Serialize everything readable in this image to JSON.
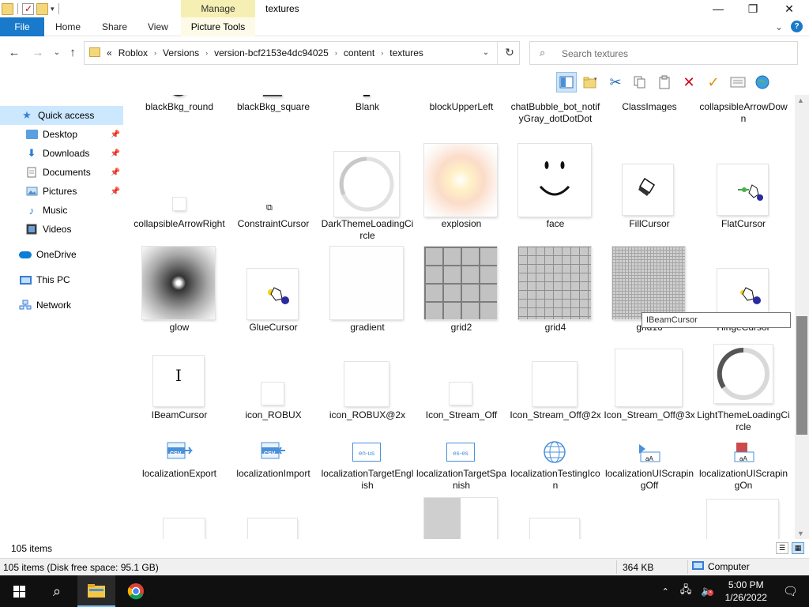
{
  "window": {
    "title": "textures",
    "manage_label": "Manage",
    "minimize": "—",
    "maximize": "❐",
    "close": "✕"
  },
  "ribbon": {
    "file": "File",
    "home": "Home",
    "share": "Share",
    "view": "View",
    "picture_tools": "Picture Tools",
    "collapse": "⌄",
    "help": "?"
  },
  "address": {
    "overflow": "«",
    "crumbs": [
      "Roblox",
      "Versions",
      "version-bcf2153e4dc94025",
      "content",
      "textures"
    ],
    "search_placeholder": "Search textures"
  },
  "navpane": {
    "items": [
      {
        "label": "Quick access",
        "icon": "star-icon"
      },
      {
        "label": "Desktop",
        "icon": "desktop-icon"
      },
      {
        "label": "Downloads",
        "icon": "downloads-icon"
      },
      {
        "label": "Documents",
        "icon": "documents-icon"
      },
      {
        "label": "Pictures",
        "icon": "pictures-icon"
      },
      {
        "label": "Music",
        "icon": "music-icon"
      },
      {
        "label": "Videos",
        "icon": "videos-icon"
      },
      {
        "label": "OneDrive",
        "icon": "onedrive-icon"
      },
      {
        "label": "This PC",
        "icon": "this-pc-icon"
      },
      {
        "label": "Network",
        "icon": "network-icon"
      }
    ]
  },
  "files": [
    {
      "name": "blackBkg_round"
    },
    {
      "name": "blackBkg_square"
    },
    {
      "name": "Blank"
    },
    {
      "name": "blockUpperLeft"
    },
    {
      "name": "chatBubble_bot_notifyGray_dotDotDot"
    },
    {
      "name": "ClassImages"
    },
    {
      "name": "collapsibleArrowDown"
    },
    {
      "name": "collapsibleArrowRight"
    },
    {
      "name": "ConstraintCursor"
    },
    {
      "name": "DarkThemeLoadingCircle"
    },
    {
      "name": "explosion"
    },
    {
      "name": "face"
    },
    {
      "name": "FillCursor"
    },
    {
      "name": "FlatCursor"
    },
    {
      "name": "glow"
    },
    {
      "name": "GlueCursor"
    },
    {
      "name": "gradient"
    },
    {
      "name": "grid2"
    },
    {
      "name": "grid4"
    },
    {
      "name": "grid16"
    },
    {
      "name": "HingeCursor"
    },
    {
      "name": "IBeamCursor"
    },
    {
      "name": "icon_ROBUX"
    },
    {
      "name": "icon_ROBUX@2x"
    },
    {
      "name": "Icon_Stream_Off"
    },
    {
      "name": "Icon_Stream_Off@2x"
    },
    {
      "name": "Icon_Stream_Off@3x"
    },
    {
      "name": "LightThemeLoadingCircle"
    },
    {
      "name": "localizationExport"
    },
    {
      "name": "localizationImport"
    },
    {
      "name": "localizationTargetEnglish"
    },
    {
      "name": "localizationTargetSpanish"
    },
    {
      "name": "localizationTestingIcon"
    },
    {
      "name": "localizationUIScrapingOff"
    },
    {
      "name": "localizationUIScrapingOn"
    }
  ],
  "thumb_text": {
    "csv": "CSV",
    "en_us": "en-us",
    "es_es": "es-es",
    "aa": "aA",
    "ibeam": "I"
  },
  "tooltip": "IBeamCursor",
  "status": {
    "count": "105 items",
    "disk": "105 items (Disk free space: 95.1 GB)",
    "size": "364 KB",
    "computer": "Computer"
  },
  "taskbar": {
    "time": "5:00 PM",
    "date": "1/26/2022"
  }
}
